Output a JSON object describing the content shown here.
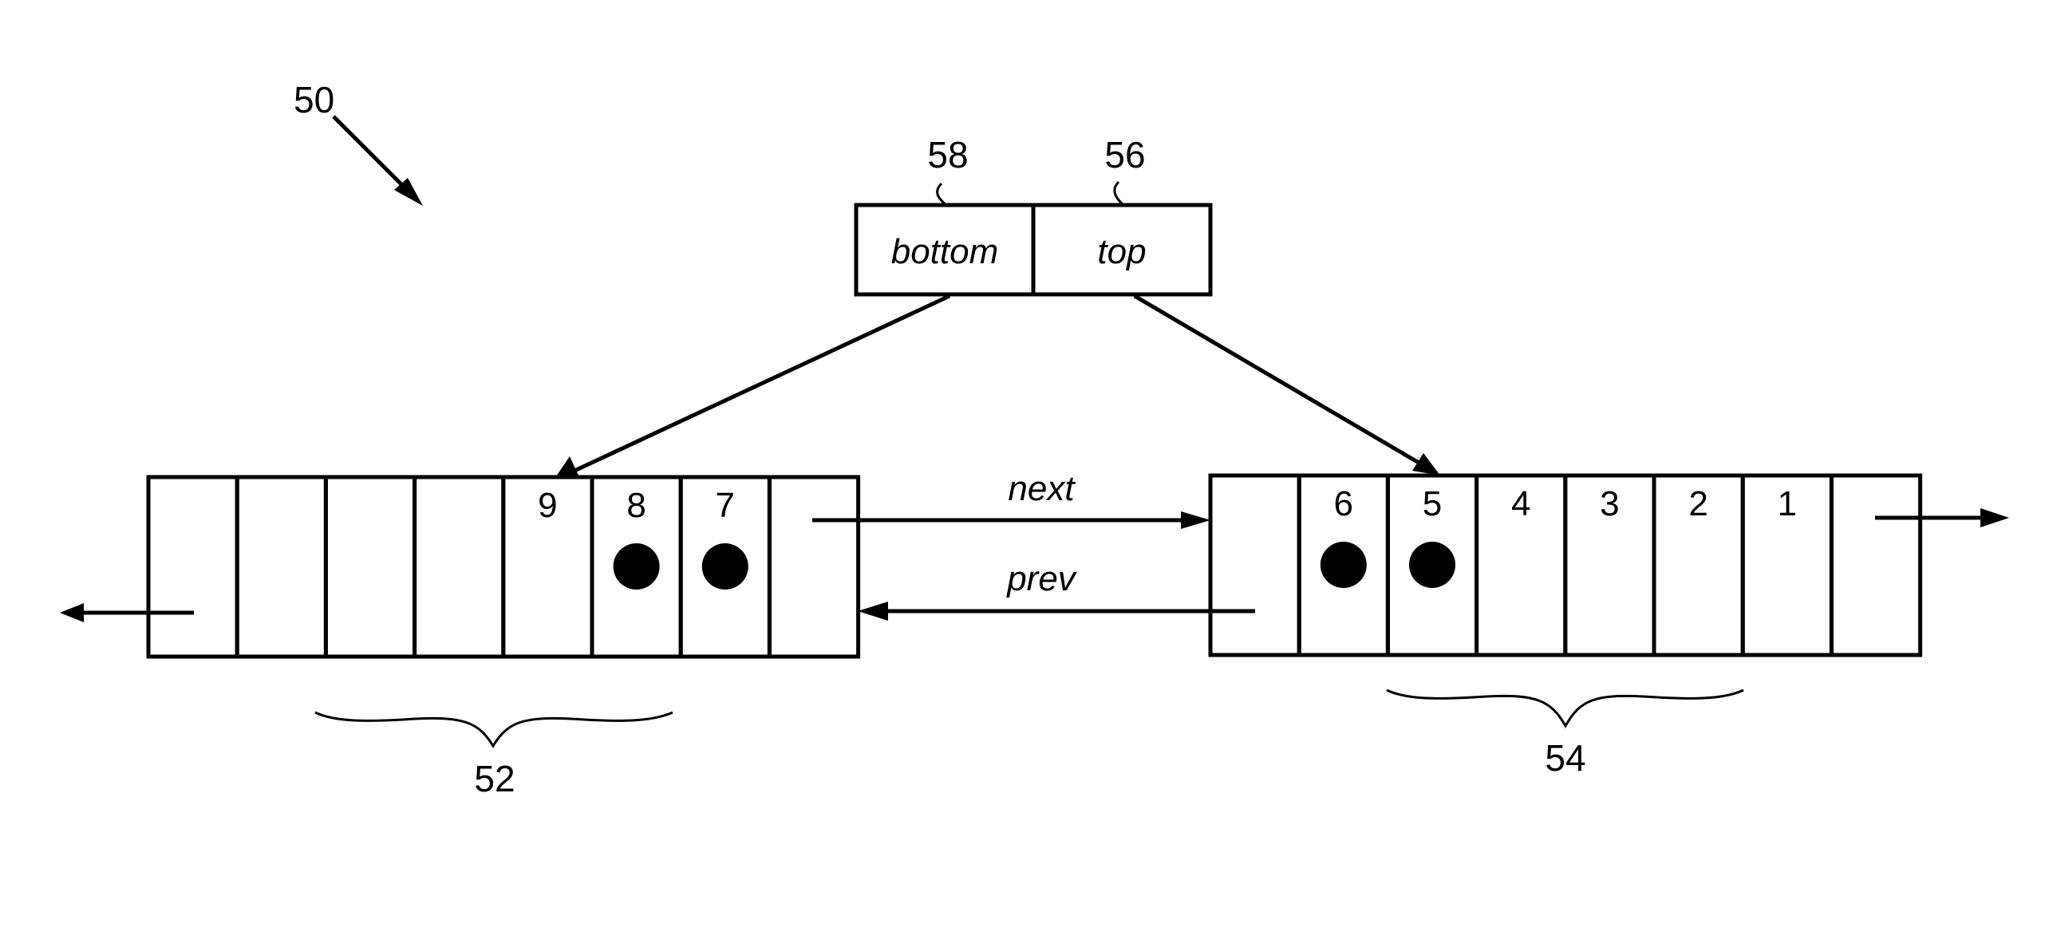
{
  "figure": {
    "ref_label": "50"
  },
  "pointer_register": {
    "bottom": {
      "ref": "58",
      "label": "bottom"
    },
    "top": {
      "ref": "56",
      "label": "top"
    }
  },
  "blocks": [
    {
      "ref": "52",
      "cells": [
        {
          "value": "",
          "filled": false
        },
        {
          "value": "",
          "filled": false
        },
        {
          "value": "",
          "filled": false
        },
        {
          "value": "",
          "filled": false
        },
        {
          "value": "9",
          "filled": false
        },
        {
          "value": "8",
          "filled": true
        },
        {
          "value": "7",
          "filled": true
        },
        {
          "value": "",
          "filled": false
        }
      ]
    },
    {
      "ref": "54",
      "cells": [
        {
          "value": "",
          "filled": false
        },
        {
          "value": "6",
          "filled": true
        },
        {
          "value": "5",
          "filled": true
        },
        {
          "value": "4",
          "filled": false
        },
        {
          "value": "3",
          "filled": false
        },
        {
          "value": "2",
          "filled": false
        },
        {
          "value": "1",
          "filled": false
        },
        {
          "value": "",
          "filled": false
        }
      ]
    }
  ],
  "links": {
    "next": "next",
    "prev": "prev"
  }
}
